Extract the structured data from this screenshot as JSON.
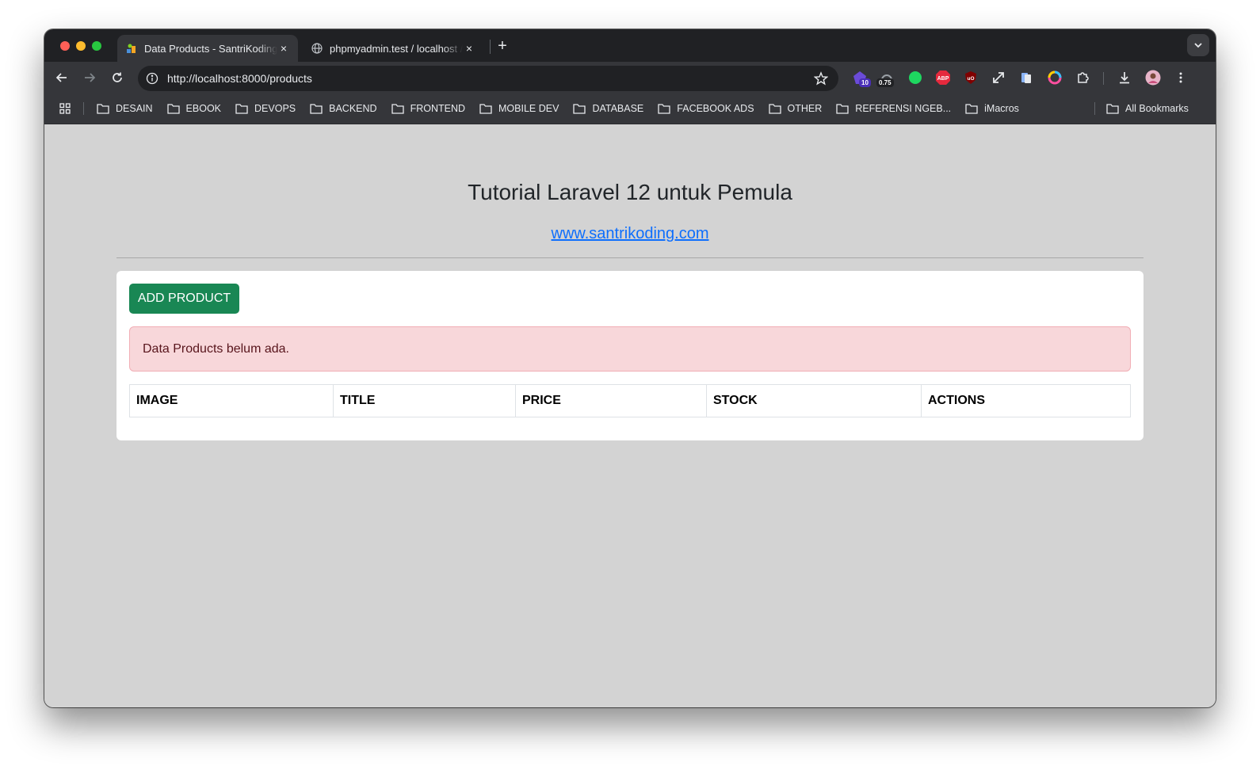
{
  "browser": {
    "tabs": [
      {
        "title": "Data Products - SantriKoding",
        "close": "×",
        "active": true
      },
      {
        "title": "phpmyadmin.test / localhost / ",
        "close": "×",
        "active": false
      }
    ],
    "new_tab": "+",
    "address": {
      "url_host": "http://localhost",
      "url_rest": ":8000/products"
    },
    "extensions": [
      {
        "name": "ext-badge-10-icon",
        "badge": "10"
      },
      {
        "name": "ext-speed-icon",
        "badge": "0.75"
      },
      {
        "name": "ext-green-dot-icon"
      },
      {
        "name": "adblock-plus-icon",
        "label": "ABP"
      },
      {
        "name": "ublock-origin-icon",
        "label": "uO"
      }
    ],
    "bookmarks": [
      "DESAIN",
      "EBOOK",
      "DEVOPS",
      "BACKEND",
      "FRONTEND",
      "MOBILE DEV",
      "DATABASE",
      "FACEBOOK ADS",
      "OTHER",
      "REFERENSI NGEB...",
      "iMacros"
    ],
    "all_bookmarks": "All Bookmarks"
  },
  "page": {
    "title": "Tutorial Laravel 12 untuk Pemula",
    "link": "www.santrikoding.com",
    "add_button": "ADD PRODUCT",
    "alert": "Data Products belum ada.",
    "table_headers": [
      "IMAGE",
      "TITLE",
      "PRICE",
      "STOCK",
      "ACTIONS"
    ]
  },
  "colors": {
    "success": "#198754",
    "danger_bg": "#f8d7da",
    "link": "#0d6efd",
    "page_bg": "#d3d3d3"
  }
}
